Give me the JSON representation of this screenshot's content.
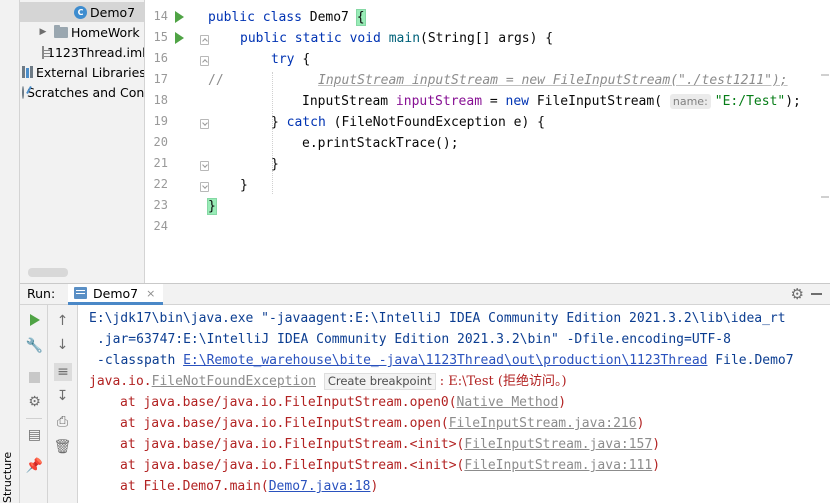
{
  "project_tree": {
    "items": [
      {
        "label": "Demo7",
        "icon": "class-icon",
        "selected": true
      },
      {
        "label": "HomeWork",
        "icon": "folder-icon"
      },
      {
        "label": "1123Thread.iml",
        "icon": "file-icon"
      },
      {
        "label": "External Libraries",
        "icon": "library-icon"
      },
      {
        "label": "Scratches and Cons",
        "icon": "scratches-icon"
      }
    ]
  },
  "side_labels": {
    "structure": "Structure"
  },
  "editor": {
    "line_numbers": [
      "14",
      "15",
      "16",
      "17",
      "18",
      "19",
      "20",
      "21",
      "22",
      "23",
      "24"
    ],
    "lines": {
      "l14": {
        "kw1": "public class ",
        "name": "Demo7 ",
        "brace": "{"
      },
      "l15": {
        "kw": "public static void ",
        "mth": "main",
        "rest": "(String[] args) {"
      },
      "l16": {
        "kw": "try ",
        "rest": "{"
      },
      "l17": {
        "prefix": "//",
        "text": "InputStream inputStream = new FileInputStream(\"./test1211\");"
      },
      "l18": {
        "type": "InputStream ",
        "var": "inputStream",
        "eq": " = ",
        "kw": "new ",
        "cls": "FileInputStream(",
        "hint": "name:",
        "str": "\"E:/Test\"",
        "end": ");"
      },
      "l19": {
        "brace": "} ",
        "kw": "catch ",
        "rest": "(FileNotFoundException e) {"
      },
      "l20": {
        "text": "e.printStackTrace();"
      },
      "l21": {
        "text": "}"
      },
      "l22": {
        "text": "}"
      },
      "l23": {
        "text": "}"
      }
    }
  },
  "run_panel": {
    "label": "Run:",
    "tab_label": "Demo7",
    "close_glyph": "×",
    "console": {
      "line1": "E:\\jdk17\\bin\\java.exe \"-javaagent:E:\\IntelliJ IDEA Community Edition 2021.3.2\\lib\\idea_rt",
      "line2": ".jar=63747:E:\\IntelliJ IDEA Community Edition 2021.3.2\\bin\" -Dfile.encoding=UTF-8",
      "line3_prefix": "-classpath ",
      "line3_link": "E:\\Remote_warehouse\\bite_-java\\1123Thread\\out\\production\\1123Thread",
      "line3_suffix": " File.Demo7",
      "err_prefix": "java.io.",
      "err_link": "FileNotFoundException",
      "create_breakpoint": "Create breakpoint",
      "err_suffix": " : E:\\Test (拒绝访问。)",
      "stack": [
        {
          "prefix": "at java.base/java.io.FileInputStream.open0(",
          "link": "Native Method",
          "suffix": ")",
          "link_style": "gray"
        },
        {
          "prefix": "at java.base/java.io.FileInputStream.open(",
          "link": "FileInputStream.java:216",
          "suffix": ")",
          "link_style": "gray"
        },
        {
          "prefix": "at java.base/java.io.FileInputStream.<init>(",
          "link": "FileInputStream.java:157",
          "suffix": ")",
          "link_style": "gray"
        },
        {
          "prefix": "at java.base/java.io.FileInputStream.<init>(",
          "link": "FileInputStream.java:111",
          "suffix": ")",
          "link_style": "gray"
        },
        {
          "prefix": "at File.Demo7.main(",
          "link": "Demo7.java:18",
          "suffix": ")",
          "link_style": "blue"
        }
      ]
    }
  },
  "colors": {
    "keyword": "#0033b3",
    "method": "#00627a",
    "variable": "#871094",
    "string": "#067d17",
    "error_text": "#b22222",
    "run_green": "#4fa345"
  }
}
